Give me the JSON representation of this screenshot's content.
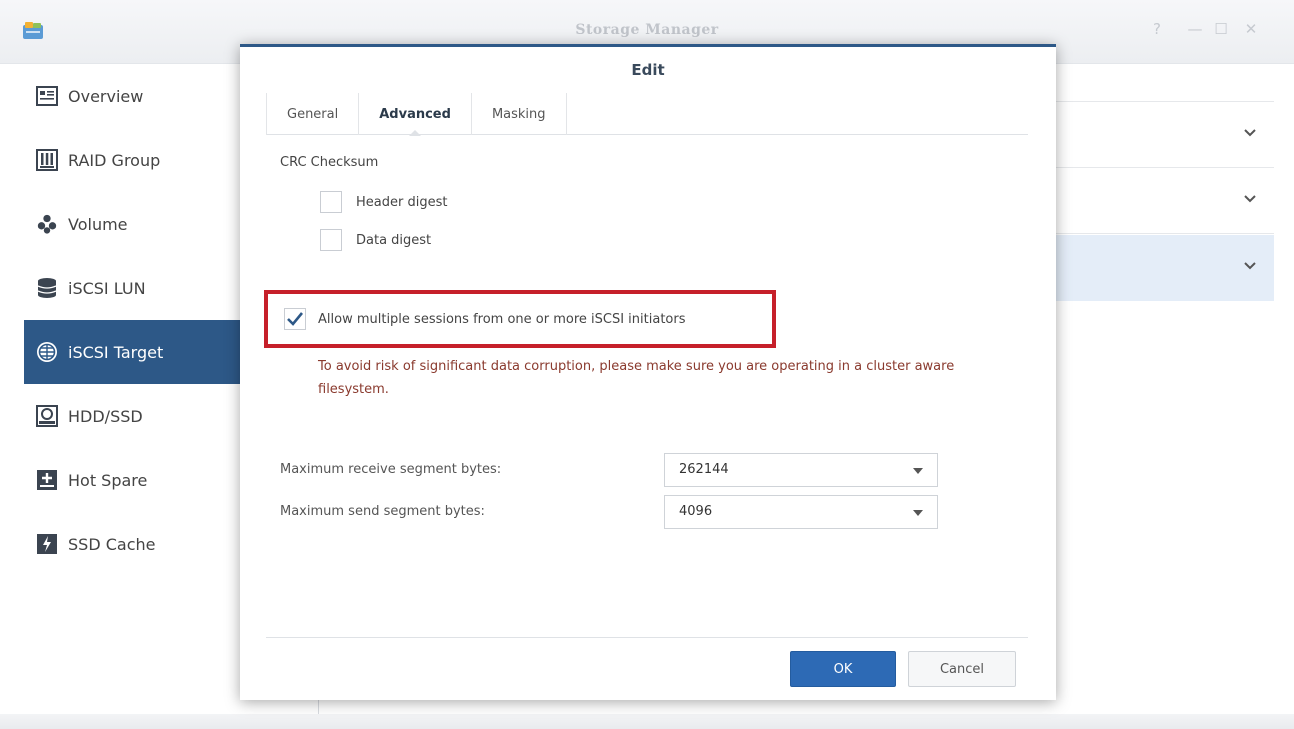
{
  "window": {
    "title": "Storage Manager",
    "controls": [
      "help-icon",
      "minimize-icon",
      "maximize-icon",
      "close-icon"
    ]
  },
  "sidebar": {
    "items": [
      {
        "label": "Overview",
        "icon": "overview-icon",
        "active": false
      },
      {
        "label": "RAID Group",
        "icon": "raid-group-icon",
        "active": false
      },
      {
        "label": "Volume",
        "icon": "volume-icon",
        "active": false
      },
      {
        "label": "iSCSI LUN",
        "icon": "iscsi-lun-icon",
        "active": false
      },
      {
        "label": "iSCSI Target",
        "icon": "iscsi-target-icon",
        "active": true
      },
      {
        "label": "HDD/SSD",
        "icon": "hdd-ssd-icon",
        "active": false
      },
      {
        "label": "Hot Spare",
        "icon": "hot-spare-icon",
        "active": false
      },
      {
        "label": "SSD Cache",
        "icon": "ssd-cache-icon",
        "active": false
      }
    ]
  },
  "dialog": {
    "title": "Edit",
    "tabs": [
      {
        "label": "General",
        "active": false
      },
      {
        "label": "Advanced",
        "active": true
      },
      {
        "label": "Masking",
        "active": false
      }
    ],
    "crc": {
      "label": "CRC Checksum",
      "header_digest": {
        "label": "Header digest",
        "checked": false
      },
      "data_digest": {
        "label": "Data digest",
        "checked": false
      }
    },
    "multi_session": {
      "label": "Allow multiple sessions from one or more iSCSI initiators",
      "checked": true,
      "warning": "To avoid risk of significant data corruption, please make sure you are operating in a cluster aware filesystem."
    },
    "max_receive": {
      "label": "Maximum receive segment bytes:",
      "value": "262144"
    },
    "max_send": {
      "label": "Maximum send segment bytes:",
      "value": "4096"
    },
    "buttons": {
      "ok": "OK",
      "cancel": "Cancel"
    }
  },
  "colors": {
    "accent": "#2d5887",
    "ok_button": "#2d6ab5",
    "highlight_border": "#c6202a",
    "warning_text": "#8a3a2e"
  }
}
